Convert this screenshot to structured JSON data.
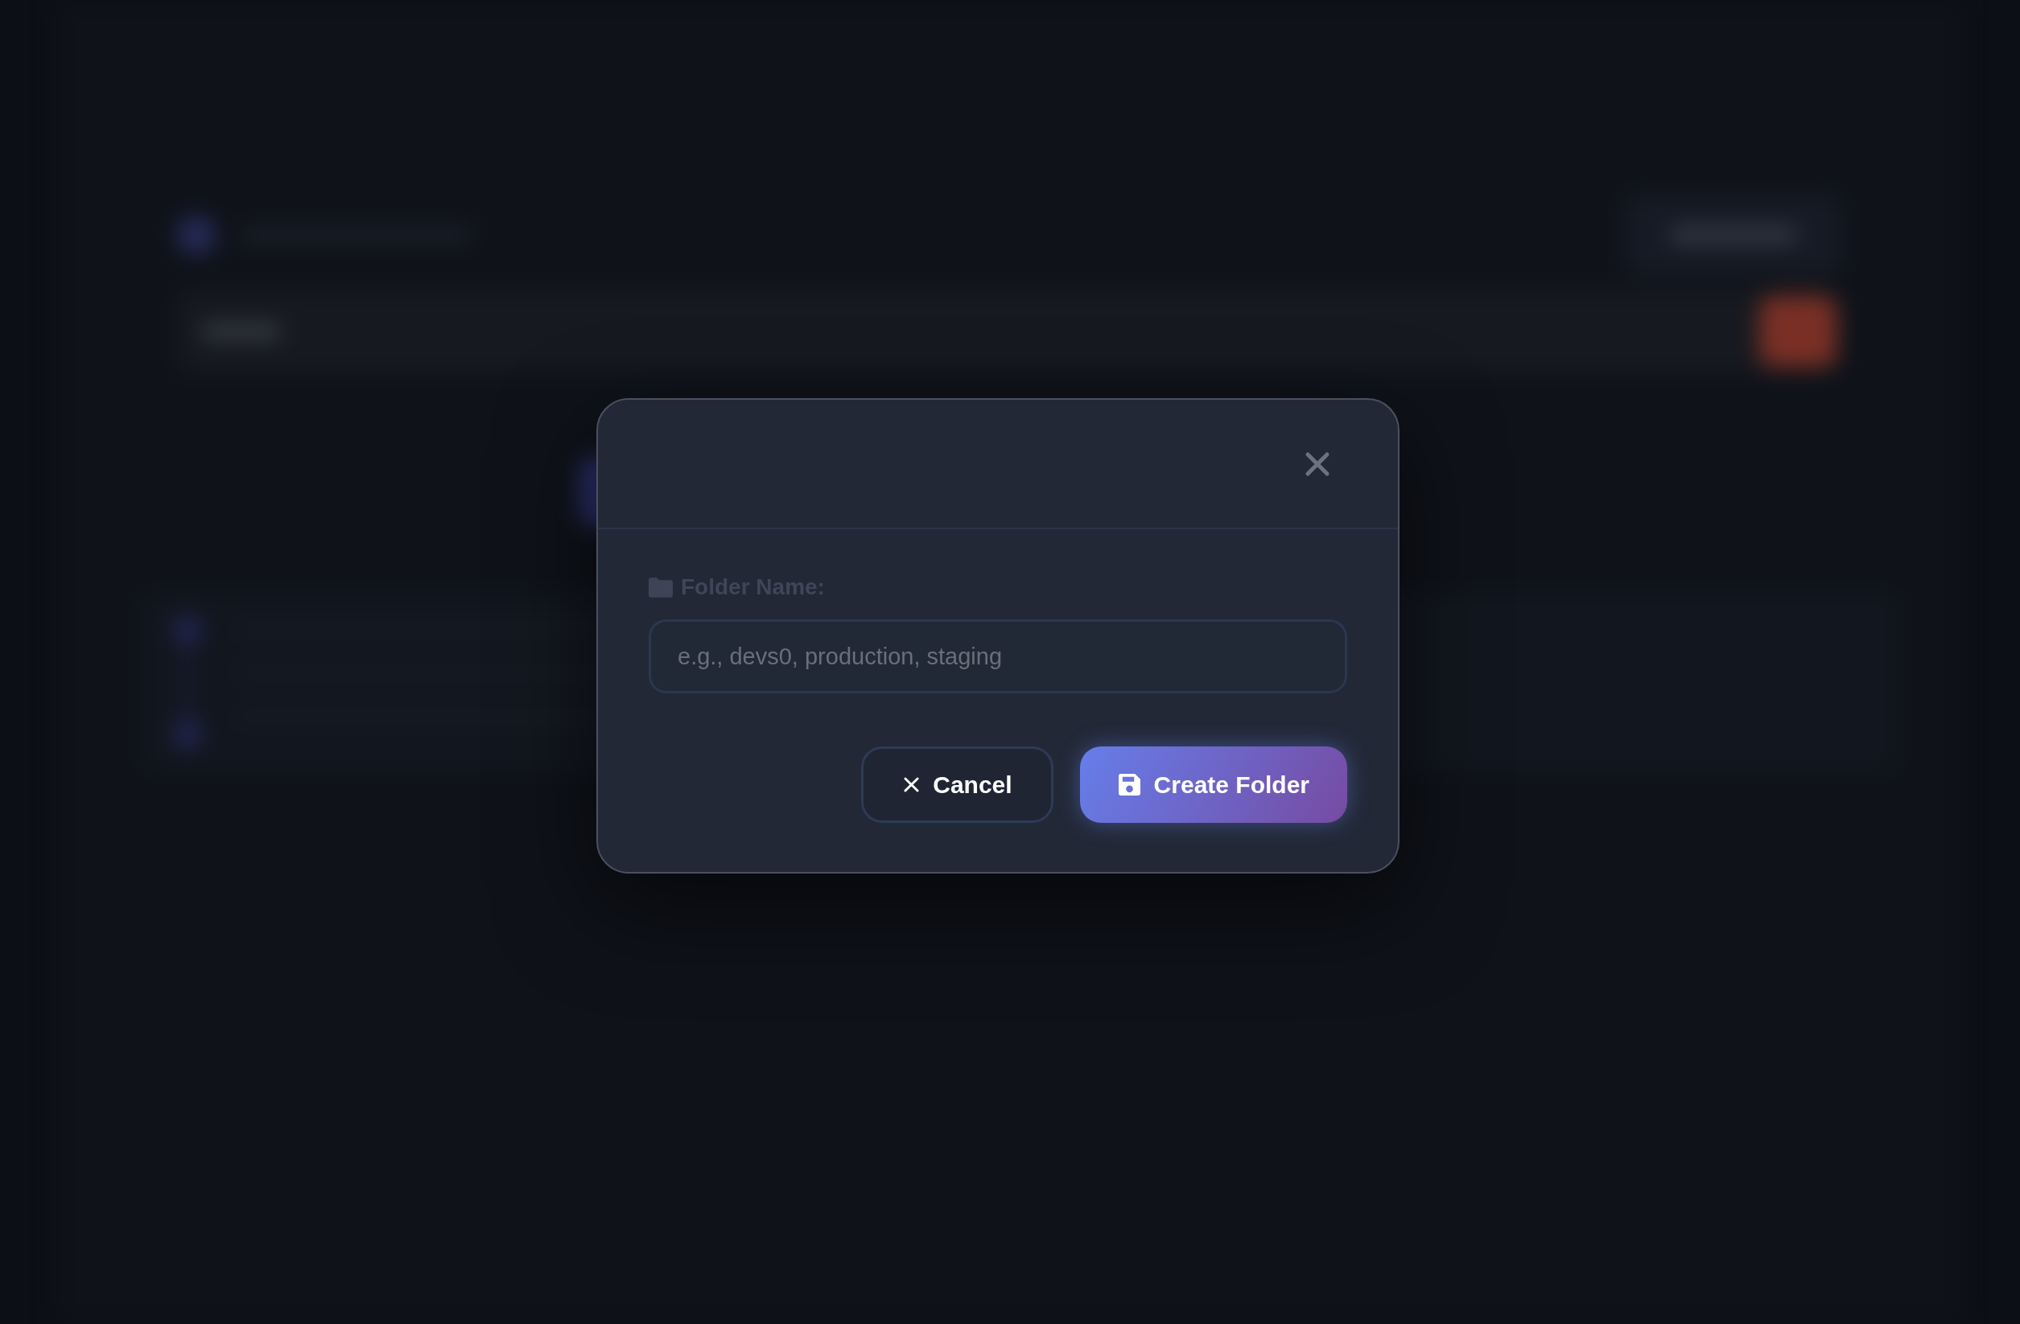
{
  "dialog": {
    "field": {
      "label": "Folder Name:",
      "placeholder": "e.g., devs0, production, staging"
    },
    "buttons": [
      {
        "label": "Cancel",
        "kind": "secondary"
      },
      {
        "label": "Create Folder",
        "kind": "primary"
      }
    ]
  }
}
